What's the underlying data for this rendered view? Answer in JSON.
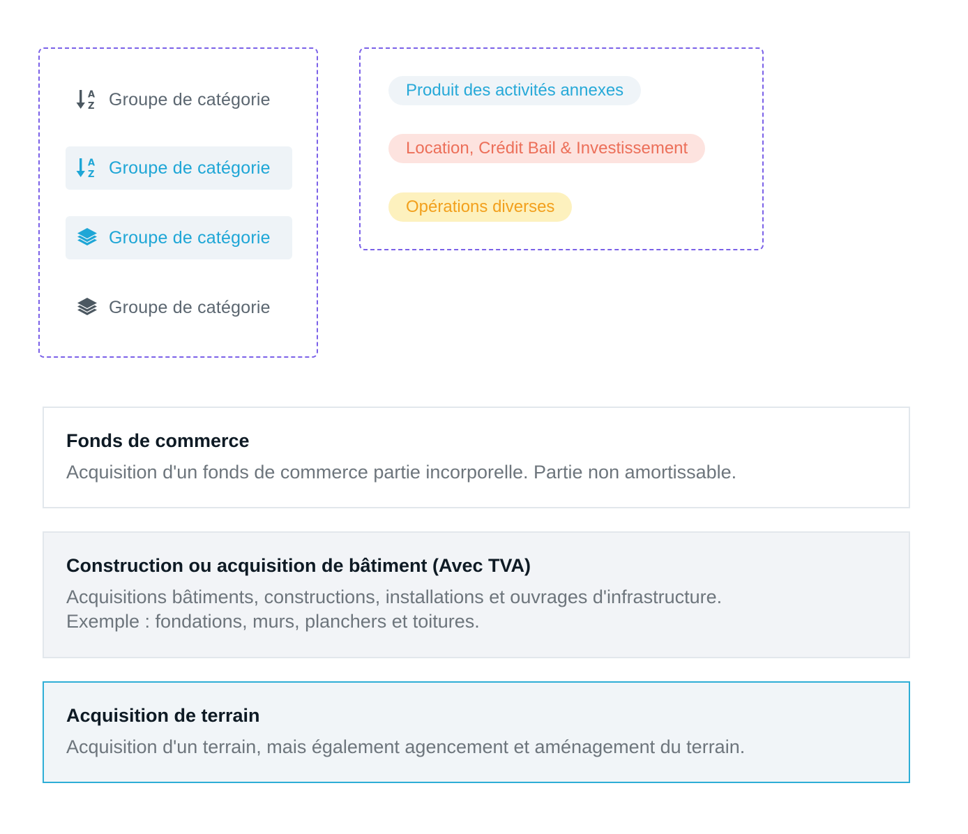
{
  "group_list": {
    "items": [
      {
        "label": "Groupe de catégorie",
        "icon": "sort-alpha-down-icon",
        "state": "default"
      },
      {
        "label": "Groupe de catégorie",
        "icon": "sort-alpha-down-icon",
        "state": "active"
      },
      {
        "label": "Groupe de catégorie",
        "icon": "layers-icon",
        "state": "active"
      },
      {
        "label": "Groupe de catégorie",
        "icon": "layers-icon",
        "state": "default"
      }
    ],
    "active_color": "#1ea6d6",
    "default_color": "#5b6670",
    "active_background": "#eef3f7"
  },
  "tags": [
    {
      "label": "Produit des activités annexes",
      "text_color": "#27a9d8",
      "background": "#eff4f8"
    },
    {
      "label": "Location, Crédit Bail & Investissement",
      "text_color": "#ec6f59",
      "background": "#fde3df"
    },
    {
      "label": "Opérations diverses",
      "text_color": "#f2a01d",
      "background": "#fdf1be"
    }
  ],
  "cards": [
    {
      "title": "Fonds de commerce",
      "description": "Acquisition d'un fonds de commerce partie incorporelle. Partie non amortissable.",
      "state": "default"
    },
    {
      "title": "Construction ou acquisition de bâtiment (Avec TVA)",
      "description_lines": [
        "Acquisitions bâtiments, constructions, installations et ouvrages d'infrastructure.",
        "Exemple : fondations, murs, planchers et toitures."
      ],
      "state": "hover"
    },
    {
      "title": "Acquisition de terrain",
      "description": "Acquisition d'un terrain, mais également agencement et aménagement du terrain.",
      "state": "selected"
    }
  ],
  "colors": {
    "dashed_border": "#7b61e8",
    "selected_border": "#2eaed6"
  }
}
